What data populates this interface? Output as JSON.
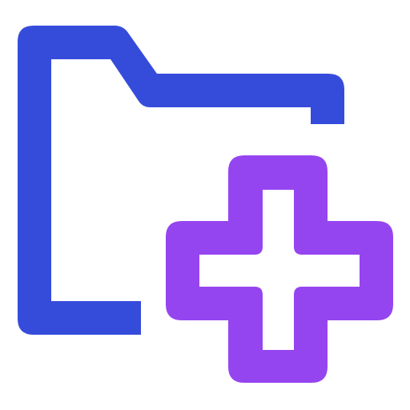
{
  "icon": {
    "name": "folder-add-icon",
    "folder_color": "#354CDB",
    "plus_color": "#9545F0",
    "background": "#FFFFFF"
  }
}
